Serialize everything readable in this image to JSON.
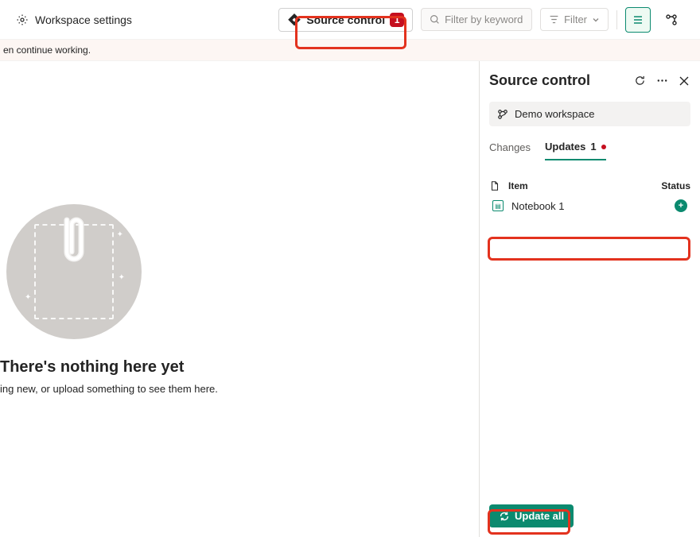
{
  "toolbar": {
    "workspace_settings": "Workspace settings",
    "source_control_label": "Source control",
    "source_control_badge": "1",
    "filter_placeholder": "Filter by keyword",
    "filter_button_label": "Filter"
  },
  "notice": {
    "text": "en continue working."
  },
  "empty_state": {
    "title": "There's nothing here yet",
    "subtitle": "ing new, or upload something to see them here."
  },
  "source_control_panel": {
    "title": "Source control",
    "branch_label": "Demo workspace",
    "tabs": {
      "changes": "Changes",
      "updates_label": "Updates",
      "updates_count": "1"
    },
    "list": {
      "item_col": "Item",
      "status_col": "Status",
      "items": [
        {
          "name": "Notebook 1",
          "status": "added"
        }
      ]
    },
    "update_all_label": "Update all"
  }
}
